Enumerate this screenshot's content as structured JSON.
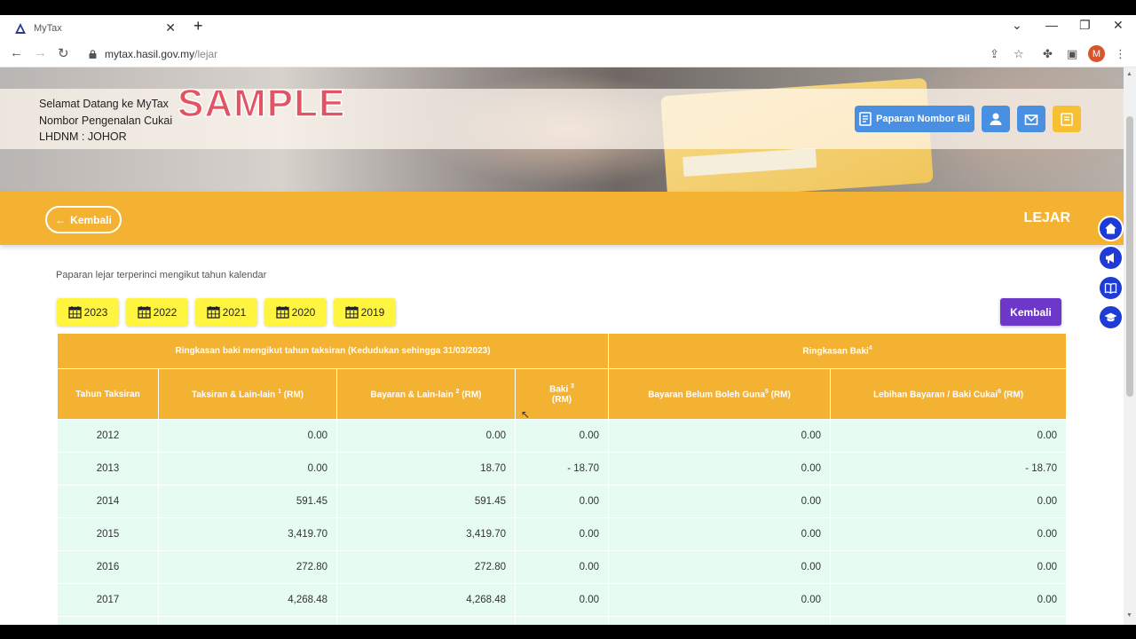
{
  "browser": {
    "tab_title": "MyTax",
    "new_tab": "+",
    "url_host": "mytax.hasil.gov.my",
    "url_path": "/lejar",
    "profile_initial": "M"
  },
  "hero": {
    "welcome_line1": "Selamat Datang ke MyTax",
    "welcome_line2": "Nombor Pengenalan Cukai",
    "welcome_line3": "LHDNM : JOHOR",
    "watermark": "SAMPLE",
    "bill_button": "Paparan Nombor Bil"
  },
  "section": {
    "back_label": "Kembali",
    "title": "LEJAR"
  },
  "content": {
    "description": "Paparan lejar terperinci mengikut tahun kalendar",
    "years": [
      "2023",
      "2022",
      "2021",
      "2020",
      "2019"
    ],
    "back_label": "Kembali"
  },
  "table": {
    "group1": "Ringkasan baki mengikut tahun taksiran (Kedudukan sehingga 31/03/2023)",
    "group2": "Ringkasan Baki",
    "group2_sup": "4",
    "headers": {
      "year": "Tahun Taksiran",
      "assessment": "Taksiran & Lain-lain",
      "assessment_sup": "1",
      "payment": "Bayaran & Lain-lain",
      "payment_sup": "2",
      "balance": "Baki",
      "balance_sup": "3",
      "unusable": "Bayaran Belum Boleh Guna",
      "unusable_sup": "5",
      "excess": "Lebihan Bayaran / Baki Cukai",
      "excess_sup": "6",
      "rm": "(RM)"
    },
    "rows": [
      {
        "year": "2012",
        "assessment": "0.00",
        "payment": "0.00",
        "balance": "0.00",
        "unusable": "0.00",
        "excess": "0.00"
      },
      {
        "year": "2013",
        "assessment": "0.00",
        "payment": "18.70",
        "balance": "- 18.70",
        "unusable": "0.00",
        "excess": "- 18.70"
      },
      {
        "year": "2014",
        "assessment": "591.45",
        "payment": "591.45",
        "balance": "0.00",
        "unusable": "0.00",
        "excess": "0.00"
      },
      {
        "year": "2015",
        "assessment": "3,419.70",
        "payment": "3,419.70",
        "balance": "0.00",
        "unusable": "0.00",
        "excess": "0.00"
      },
      {
        "year": "2016",
        "assessment": "272.80",
        "payment": "272.80",
        "balance": "0.00",
        "unusable": "0.00",
        "excess": "0.00"
      },
      {
        "year": "2017",
        "assessment": "4,268.48",
        "payment": "4,268.48",
        "balance": "0.00",
        "unusable": "0.00",
        "excess": "0.00"
      }
    ]
  },
  "colors": {
    "accent": "#f4b233",
    "row_bg": "#e6fbf2",
    "year_button": "#fff43f",
    "back_button": "#6d37c9",
    "float_button": "#1f3bd6"
  }
}
